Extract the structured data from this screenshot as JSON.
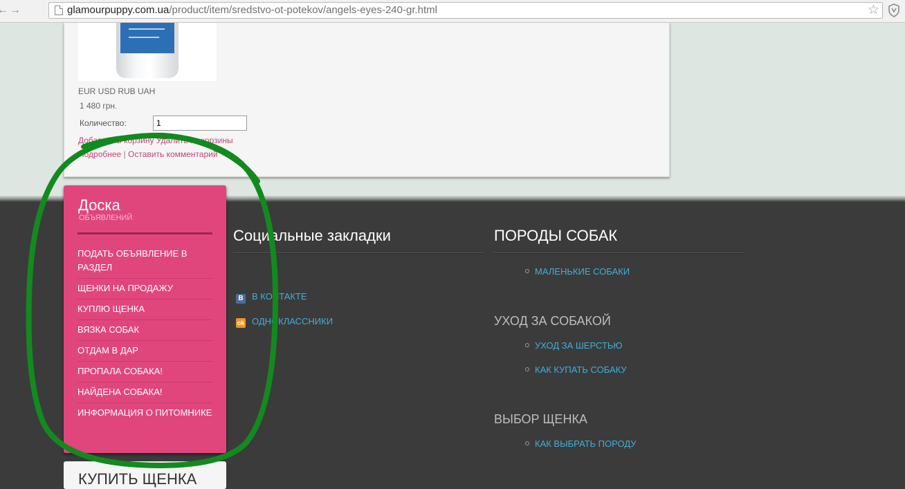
{
  "browser": {
    "url_host": "glamourpuppy.com.ua",
    "url_path": "/product/item/sredstvo-ot-potekov/angels-eyes-240-gr.html"
  },
  "product": {
    "currencies": "EUR USD RUB UAH",
    "price": "1 480 грн.",
    "quantity_label": "Количество:",
    "quantity_value": "1",
    "add_to_cart": "Добавить в корзину",
    "remove_from_cart": "Удалить из корзины",
    "details": "Подробнее",
    "separator": "|",
    "leave_comment": "Оставить комментарий"
  },
  "board": {
    "title": "Доска",
    "subtitle": "ОБЪЯВЛЕНИЙ",
    "items": [
      {
        "label": "ПОДАТЬ ОБЪЯВЛЕНИЕ В РАЗДЕЛ"
      },
      {
        "label": "ЩЕНКИ НА ПРОДАЖУ"
      },
      {
        "label": "КУПЛЮ ЩЕНКА"
      },
      {
        "label": "ВЯЗКА СОБАК"
      },
      {
        "label": "ОТДАМ В ДАР"
      },
      {
        "label": "ПРОПАЛА СОБАКА!"
      },
      {
        "label": "НАЙДЕНА СОБАКА!"
      },
      {
        "label": "ИНФОРМАЦИЯ О ПИТОМНИКЕ"
      }
    ]
  },
  "buy_puppy": {
    "title": "КУПИТЬ ЩЕНКА"
  },
  "social": {
    "heading": "Социальные закладки",
    "vk_label": "В КОНТАКТЕ",
    "ok_label": "ОДНОКЛАССНИКИ"
  },
  "breeds": {
    "heading": "ПОРОДЫ СОБАК",
    "small_dogs": "МАЛЕНЬКИЕ СОБАКИ",
    "care_heading": "УХОД ЗА СОБАКОЙ",
    "coat_care": "УХОД ЗА ШЕРСТЬЮ",
    "bathing": "КАК КУПАТЬ СОБАКУ",
    "choice_heading": "ВЫБОР ЩЕНКА",
    "choose_breed": "КАК ВЫБРАТЬ ПОРОДУ"
  },
  "colors": {
    "pink": "#e0467c",
    "link_blue": "#3fb0d8",
    "link_pink": "#c0457a",
    "annotation_green": "#128a1e",
    "footer_bg": "#3b3b3b"
  }
}
